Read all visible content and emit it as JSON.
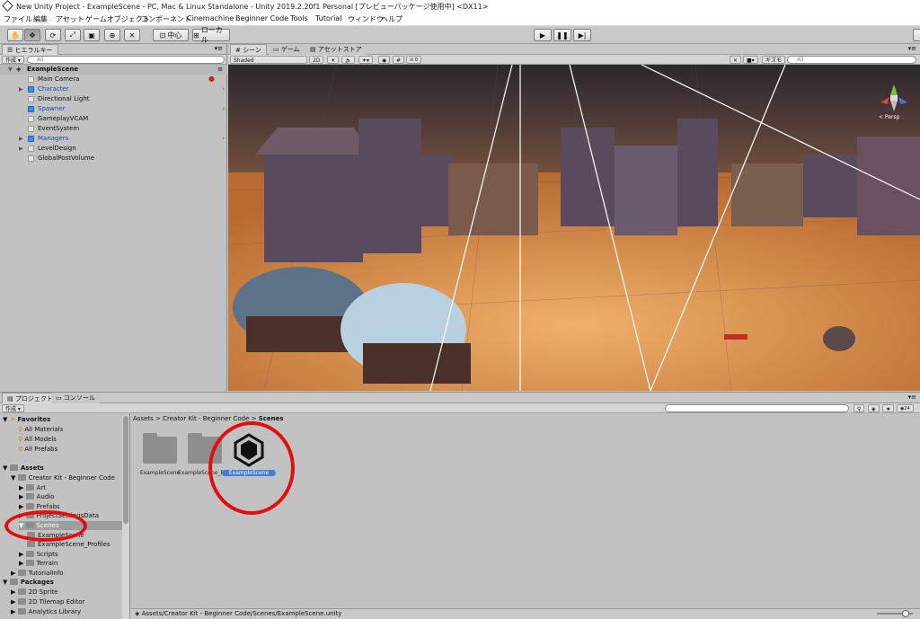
{
  "window": {
    "title": "New Unity Project - ExampleScene - PC, Mac & Linux Standalone - Unity 2019.2.20f1 Personal [プレビューパッケージ使用中] <DX11>"
  },
  "menu": [
    "ファイル",
    "編集",
    "アセット",
    "ゲームオブジェクト",
    "コンポーネント",
    "Cinemachine",
    "Beginner Code",
    "Tools",
    "Tutorial",
    "ウィンドウ",
    "ヘルプ"
  ],
  "toolbar": {
    "pivot_label": "中心",
    "space_label": "ローカル",
    "tools": [
      "hand-tool",
      "move-tool",
      "rotate-tool",
      "scale-tool",
      "rect-tool",
      "transform-tool",
      "custom-tool"
    ]
  },
  "hierarchy": {
    "tab": "ヒエラルキー",
    "create_label": "作成 ▾",
    "search_placeholder": "All",
    "scene_name": "ExampleScene",
    "items": [
      {
        "label": "Main Camera",
        "color": "gray",
        "expandable": false,
        "prefab": false
      },
      {
        "label": "Character",
        "color": "blue",
        "expandable": true,
        "prefab": true
      },
      {
        "label": "Directional Light",
        "color": "gray",
        "expandable": false,
        "prefab": false
      },
      {
        "label": "Spawner",
        "color": "blue",
        "expandable": false,
        "prefab": true
      },
      {
        "label": "GameplayVCAM",
        "color": "gray",
        "expandable": false,
        "prefab": false
      },
      {
        "label": "EventSystem",
        "color": "gray",
        "expandable": false,
        "prefab": false
      },
      {
        "label": "Managers",
        "color": "blue",
        "expandable": true,
        "prefab": true
      },
      {
        "label": "LevelDesign",
        "color": "gray",
        "expandable": true,
        "prefab": false
      },
      {
        "label": "GlobalPostVolume",
        "color": "gray",
        "expandable": false,
        "prefab": false
      }
    ]
  },
  "scene_view": {
    "tabs": [
      "シーン",
      "ゲーム",
      "アセットストア"
    ],
    "shading": "Shaded",
    "mode_2d": "2D",
    "gizmos": "ギズモ",
    "search_placeholder": "All",
    "persp_label": "< Persp",
    "fx_count": "0"
  },
  "project": {
    "tabs": [
      "プロジェクト",
      "コンソール"
    ],
    "create_label": "作成 ▾",
    "count": "24",
    "favorites_label": "Favorites",
    "favorites": [
      "All Materials",
      "All Models",
      "All Prefabs"
    ],
    "tree": [
      {
        "label": "Assets",
        "depth": 0,
        "expanded": true
      },
      {
        "label": "Creator Kit - Beginner Code",
        "depth": 1,
        "expanded": true
      },
      {
        "label": "Art",
        "depth": 2,
        "expanded": false
      },
      {
        "label": "Audio",
        "depth": 2,
        "expanded": false
      },
      {
        "label": "Prefabs",
        "depth": 2,
        "expanded": false
      },
      {
        "label": "ProjectSettingsData",
        "depth": 2,
        "expanded": false
      },
      {
        "label": "Scenes",
        "depth": 2,
        "expanded": true,
        "selected": true
      },
      {
        "label": "ExampleScene",
        "depth": 3,
        "expanded": false
      },
      {
        "label": "ExampleScene_Profiles",
        "depth": 3,
        "expanded": false
      },
      {
        "label": "Scripts",
        "depth": 2,
        "expanded": false
      },
      {
        "label": "Terrain",
        "depth": 2,
        "expanded": false
      },
      {
        "label": "TutorialInfo",
        "depth": 1,
        "expanded": false
      }
    ],
    "packages_label": "Packages",
    "packages": [
      "2D Sprite",
      "2D Tilemap Editor",
      "Analytics Library"
    ],
    "breadcrumb": [
      "Assets",
      "Creator Kit - Beginner Code",
      "Scenes"
    ],
    "assets": [
      {
        "label": "ExampleScene",
        "kind": "folder"
      },
      {
        "label": "ExampleScene_Profiles",
        "kind": "folder"
      },
      {
        "label": "ExampleScene",
        "kind": "unity-scene",
        "selected": true
      }
    ],
    "status_path": "Assets/Creator Kit - Beginner Code/Scenes/ExampleScene.unity"
  }
}
